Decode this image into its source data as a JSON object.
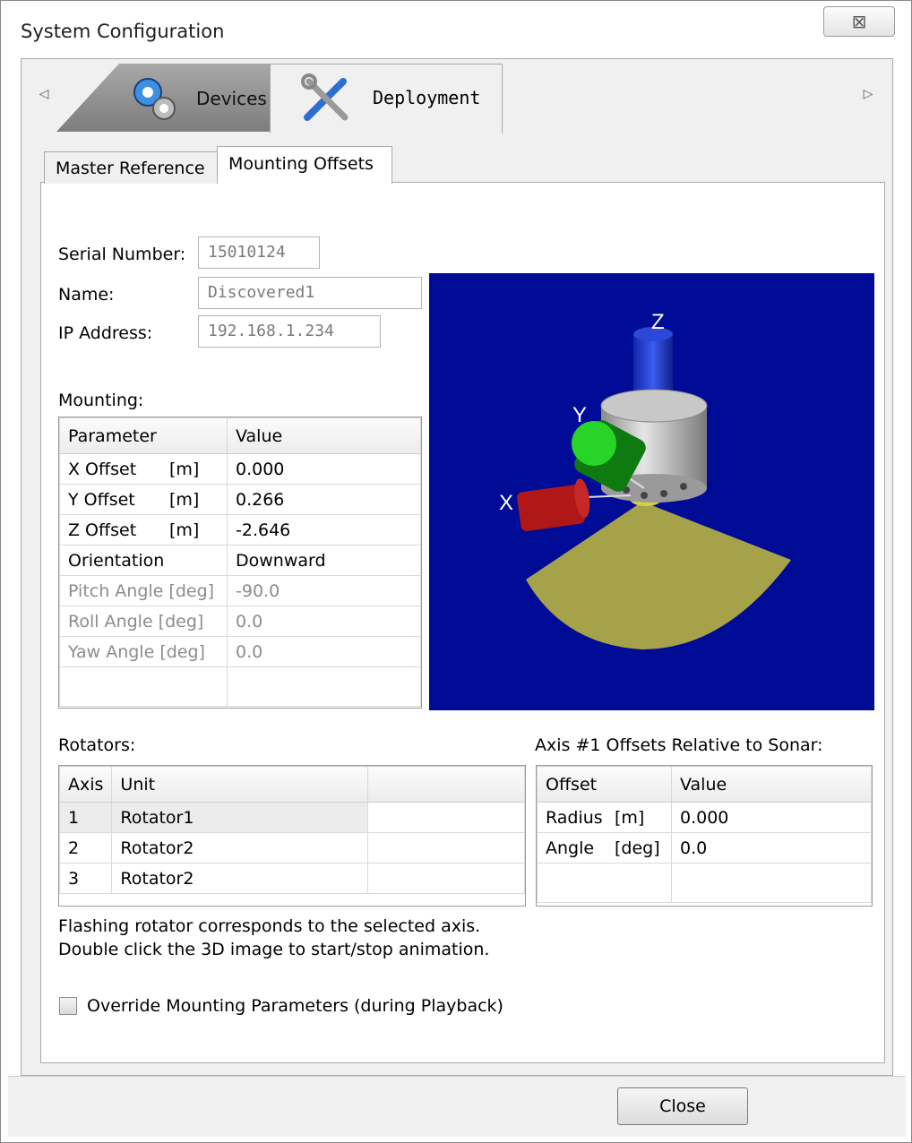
{
  "window": {
    "title": "System Configuration",
    "close_glyph": "⊠"
  },
  "main_tabs": [
    {
      "label": "Devices",
      "icon": "gears-icon"
    },
    {
      "label": "Deployment",
      "icon": "tools-icon"
    }
  ],
  "nav": {
    "left_arrow": "◁",
    "right_arrow": "▷"
  },
  "sub_tabs": [
    {
      "label": "Master Reference"
    },
    {
      "label": "Mounting Offsets"
    }
  ],
  "device": {
    "serial_label": "Serial Number:",
    "serial_value": "15010124",
    "name_label": "Name:",
    "name_value": "Discovered1",
    "ip_label": "IP Address:",
    "ip_value": "192.168.1.234"
  },
  "mounting": {
    "label": "Mounting:",
    "headers": [
      "Parameter",
      "Value"
    ],
    "rows": [
      {
        "param": "X Offset",
        "unit": "[m]",
        "value": "0.000",
        "disabled": false
      },
      {
        "param": "Y Offset",
        "unit": "[m]",
        "value": "0.266",
        "disabled": false
      },
      {
        "param": "Z Offset",
        "unit": "[m]",
        "value": "-2.646",
        "disabled": false
      },
      {
        "param": "Orientation",
        "unit": "",
        "value": "Downward",
        "disabled": false
      },
      {
        "param": "Pitch Angle [deg]",
        "unit": "",
        "value": "-90.0",
        "disabled": true
      },
      {
        "param": "Roll Angle  [deg]",
        "unit": "",
        "value": "0.0",
        "disabled": true
      },
      {
        "param": "Yaw Angle [deg]",
        "unit": "",
        "value": "0.0",
        "disabled": true
      }
    ]
  },
  "view3d": {
    "axis_x": "X",
    "axis_y": "Y",
    "axis_z": "Z",
    "colors": {
      "background": "#000b96",
      "x_axis": "#b01818",
      "y_axis": "#1fc21f",
      "z_axis": "#1c3fd6",
      "beam": "#a6a24a",
      "housing": "#c8c8c8"
    }
  },
  "rotators": {
    "label": "Rotators:",
    "headers": [
      "Axis",
      "Unit",
      ""
    ],
    "rows": [
      {
        "axis": "1",
        "unit": "Rotator1"
      },
      {
        "axis": "2",
        "unit": "Rotator2"
      },
      {
        "axis": "3",
        "unit": "Rotator2"
      }
    ]
  },
  "axis_offsets": {
    "label": "Axis #1 Offsets Relative to Sonar:",
    "headers": [
      "Offset",
      "Value"
    ],
    "rows": [
      {
        "offset": "Radius",
        "unit": "[m]",
        "value": "0.000"
      },
      {
        "offset": "Angle",
        "unit": "[deg]",
        "value": "0.0"
      }
    ]
  },
  "hints": {
    "line1": "Flashing rotator corresponds to the selected axis.",
    "line2": "Double click the 3D image to start/stop animation."
  },
  "override": {
    "label": "Override Mounting Parameters (during Playback)",
    "checked": false
  },
  "buttons": {
    "close": "Close"
  }
}
